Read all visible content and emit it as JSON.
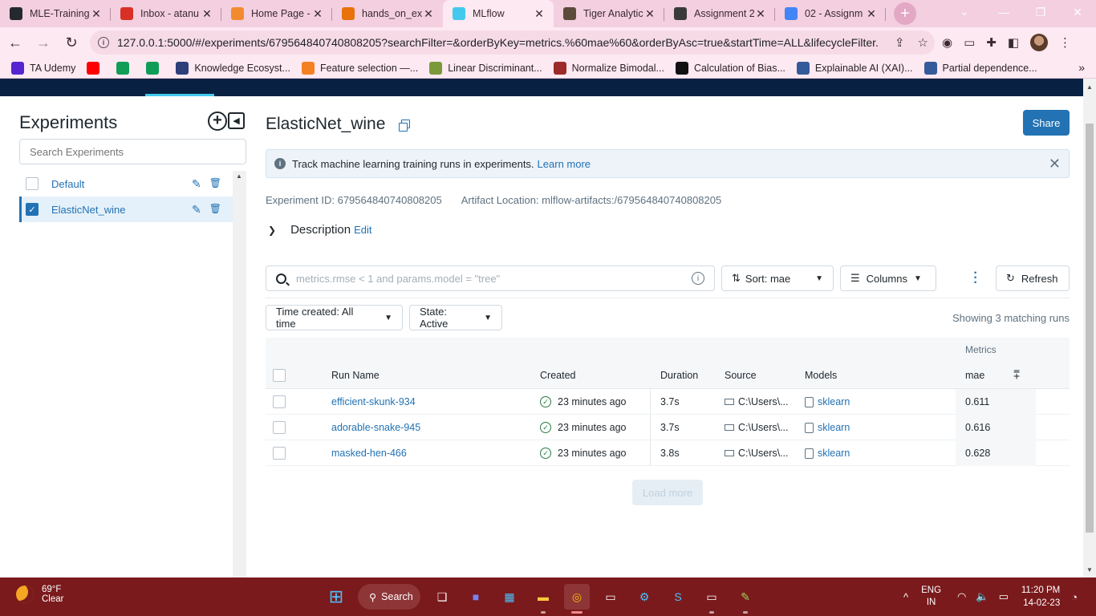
{
  "browser": {
    "tabs": [
      {
        "title": "MLE-Training",
        "favicon": "github-icon",
        "color": "#24292f",
        "active": false
      },
      {
        "title": "Inbox - atanu",
        "favicon": "gmail-icon",
        "color": "#d93025",
        "active": false
      },
      {
        "title": "Home Page -",
        "favicon": "spinner-icon",
        "color": "#f28b30",
        "active": false
      },
      {
        "title": "hands_on_exa",
        "favicon": "notebook-icon",
        "color": "#e8710a",
        "active": false
      },
      {
        "title": "MLflow",
        "favicon": "mlflow-icon",
        "color": "#43c9ed",
        "active": true
      },
      {
        "title": "Tiger Analytic",
        "favicon": "tiger-icon",
        "color": "#5c4a3a",
        "active": false
      },
      {
        "title": "Assignment 2",
        "favicon": "assignment-icon",
        "color": "#3a3a3a",
        "active": false
      },
      {
        "title": "02 - Assignm",
        "favicon": "docs-icon",
        "color": "#4285f4",
        "active": false
      }
    ],
    "url_main": "127.0.0.1:5000/#/experiments/679564840740808205?searchFilter=&orderByKey=metrics.%60mae%60&orderByAsc=true&startTime=ALL&lifecycleFilter...",
    "bookmarks": [
      {
        "label": "TA Udemy",
        "icon": "udemy-icon",
        "color": "#5624d0"
      },
      {
        "label": "",
        "icon": "youtube-icon",
        "color": "#ff0000"
      },
      {
        "label": "",
        "icon": "sheets-icon",
        "color": "#0f9d58"
      },
      {
        "label": "",
        "icon": "sheets-icon",
        "color": "#0f9d58"
      },
      {
        "label": "Knowledge Ecosyst...",
        "icon": "knowledge-icon",
        "color": "#2d3e7a"
      },
      {
        "label": "Feature selection —...",
        "icon": "stackoverflow-icon",
        "color": "#f48024"
      },
      {
        "label": "Linear Discriminant...",
        "icon": "medium-icon",
        "color": "#7a9a3a"
      },
      {
        "label": "Normalize Bimodal...",
        "icon": "b-icon",
        "color": "#9c2a2a"
      },
      {
        "label": "Calculation of Bias...",
        "icon": "medium-icon",
        "color": "#111111"
      },
      {
        "label": "Explainable AI (XAI)...",
        "icon": "tds-icon",
        "color": "#355a9a"
      },
      {
        "label": "Partial dependence...",
        "icon": "tds-icon",
        "color": "#355a9a"
      }
    ]
  },
  "sidebar": {
    "title": "Experiments",
    "search_placeholder": "Search Experiments",
    "experiments": [
      {
        "name": "Default",
        "selected": false
      },
      {
        "name": "ElasticNet_wine",
        "selected": true
      }
    ]
  },
  "main": {
    "title": "ElasticNet_wine",
    "share_label": "Share",
    "banner_text": "Track machine learning training runs in experiments.",
    "banner_link": "Learn more",
    "experiment_id": "Experiment ID: 679564840740808205",
    "artifact_location": "Artifact Location: mlflow-artifacts:/679564840740808205",
    "description_label": "Description",
    "description_edit": "Edit",
    "search_placeholder": "metrics.rmse < 1 and params.model = \"tree\"",
    "sort_label": "Sort: mae",
    "columns_label": "Columns",
    "refresh_label": "Refresh",
    "time_filter": "Time created: All time",
    "state_filter": "State: Active",
    "showing": "Showing 3 matching runs",
    "load_more": "Load more"
  },
  "table": {
    "group_header": "Metrics",
    "columns": {
      "run_name": "Run Name",
      "created": "Created",
      "duration": "Duration",
      "source": "Source",
      "models": "Models",
      "mae": "mae"
    },
    "rows": [
      {
        "name": "efficient-skunk-934",
        "created": "23 minutes ago",
        "duration": "3.7s",
        "source": "C:\\Users\\...",
        "model": "sklearn",
        "mae": "0.611"
      },
      {
        "name": "adorable-snake-945",
        "created": "23 minutes ago",
        "duration": "3.7s",
        "source": "C:\\Users\\...",
        "model": "sklearn",
        "mae": "0.616"
      },
      {
        "name": "masked-hen-466",
        "created": "23 minutes ago",
        "duration": "3.8s",
        "source": "C:\\Users\\...",
        "model": "sklearn",
        "mae": "0.628"
      }
    ]
  },
  "taskbar": {
    "temp": "69°F",
    "weather": "Clear",
    "search_label": "Search",
    "lang1": "ENG",
    "lang2": "IN",
    "time": "11:20 PM",
    "date": "14-02-23"
  }
}
